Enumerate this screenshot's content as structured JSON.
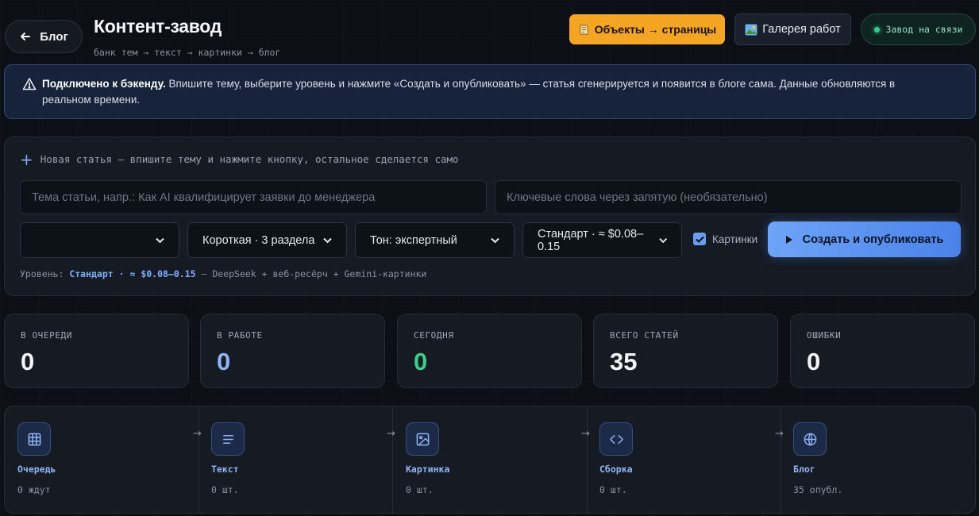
{
  "header": {
    "back_label": "Блог",
    "title": "Контент-завод",
    "subtitle": "банк тем → текст → картинки → блог",
    "objects_button": "Объекты → страницы",
    "gallery_button": "Галерея работ",
    "status": "Завод на связи"
  },
  "alert": {
    "bold": "Подключено к бэкенду.",
    "text": " Впишите тему, выберите уровень и нажмите «Создать и опубликовать» — статья сгенерируется и появится в блоге сама. Данные обновляются в реальном времени."
  },
  "create_form": {
    "heading": "Новая статья — впишите тему и нажмите кнопку, остальное сделается само",
    "topic_placeholder": "Тема статьи, напр.: Как AI квалифицирует заявки до менеджера",
    "keywords_placeholder": "Ключевые слова через запятую (необязательно)",
    "select_1_value": "",
    "length_value": "Короткая · 3 раздела",
    "tone_value": "Тон: экспертный",
    "level_value": "Стандарт · ≈ $0.08–0.15",
    "images_label": "Картинки",
    "images_checked": true,
    "submit_label": "Создать и опубликовать",
    "level_prefix": "Уровень: ",
    "level_highlight": "Стандарт · ≈ $0.08–0.15",
    "level_suffix": " — DeepSeek + веб-ресёрч + Gemini-картинки"
  },
  "stats": [
    {
      "label": "В ОЧЕРЕДИ",
      "value": "0",
      "color": "#f4f6fa"
    },
    {
      "label": "В РАБОТЕ",
      "value": "0",
      "color": "#8fb5f5"
    },
    {
      "label": "СЕГОДНЯ",
      "value": "0",
      "color": "#3ecf8e"
    },
    {
      "label": "ВСЕГО СТАТЕЙ",
      "value": "35",
      "color": "#f4f6fa"
    },
    {
      "label": "ОШИБКИ",
      "value": "0",
      "color": "#f4f6fa"
    }
  ],
  "pipeline": [
    {
      "name": "Очередь",
      "count": "0 ждут",
      "icon": "grid-icon"
    },
    {
      "name": "Текст",
      "count": "0 шт.",
      "icon": "text-lines-icon"
    },
    {
      "name": "Картинка",
      "count": "0 шт.",
      "icon": "image-icon"
    },
    {
      "name": "Сборка",
      "count": "0 шт.",
      "icon": "code-icon"
    },
    {
      "name": "Блог",
      "count": "35 опубл.",
      "icon": "globe-icon"
    }
  ]
}
